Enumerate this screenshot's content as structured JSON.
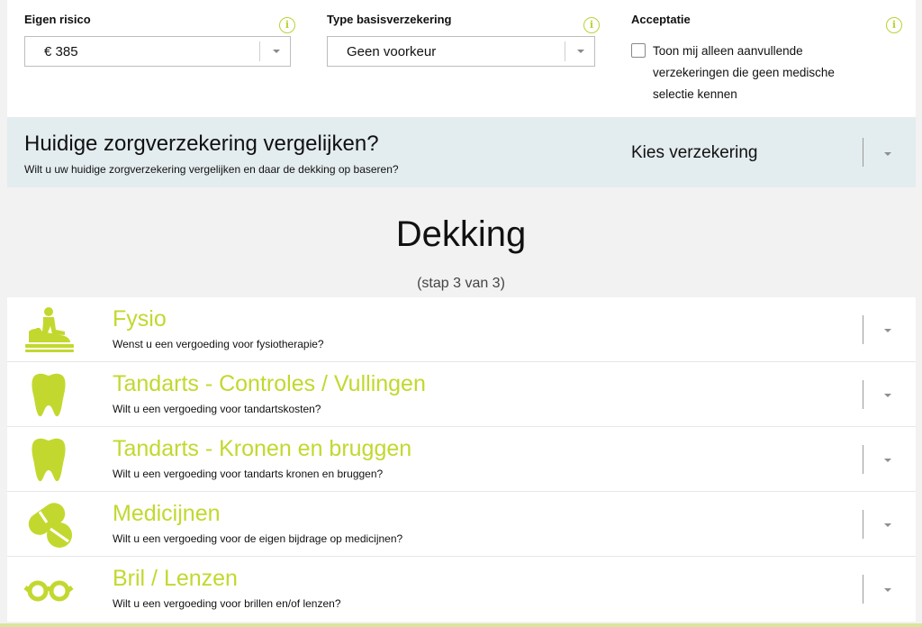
{
  "filters": {
    "eigen_risico": {
      "label": "Eigen risico",
      "value": "€ 385"
    },
    "type": {
      "label": "Type basisverzekering",
      "value": "Geen voorkeur"
    },
    "acceptatie": {
      "label": "Acceptatie",
      "checkbox_label": "Toon mij alleen aanvullende verzekeringen die geen medische selectie kennen",
      "checked": false
    },
    "info_glyph": "i"
  },
  "current": {
    "title": "Huidige zorgverzekering vergelijken?",
    "subtitle": "Wilt u uw huidige zorgverzekering vergelijken en daar de dekking op baseren?",
    "choose": "Kies verzekering"
  },
  "section": {
    "title": "Dekking",
    "step": "(stap 3 van 3)"
  },
  "coverage": [
    {
      "icon": "physio-icon",
      "title": "Fysio",
      "subtitle": "Wenst u een vergoeding voor fysiotherapie?"
    },
    {
      "icon": "tooth-icon",
      "title": "Tandarts - Controles / Vullingen",
      "subtitle": "Wilt u een vergoeding voor tandartskosten?"
    },
    {
      "icon": "tooth-icon",
      "title": "Tandarts - Kronen en bruggen",
      "subtitle": "Wilt u een vergoeding voor tandarts kronen en bruggen?"
    },
    {
      "icon": "pills-icon",
      "title": "Medicijnen",
      "subtitle": "Wilt u een vergoeding voor de eigen bijdrage op medicijnen?"
    },
    {
      "icon": "glasses-icon",
      "title": "Bril / Lenzen",
      "subtitle": "Wilt u een vergoeding voor brillen en/of lenzen?"
    }
  ],
  "colors": {
    "accent": "#c3d82e",
    "band": "#e3ecee",
    "background": "#f2f2f2"
  }
}
